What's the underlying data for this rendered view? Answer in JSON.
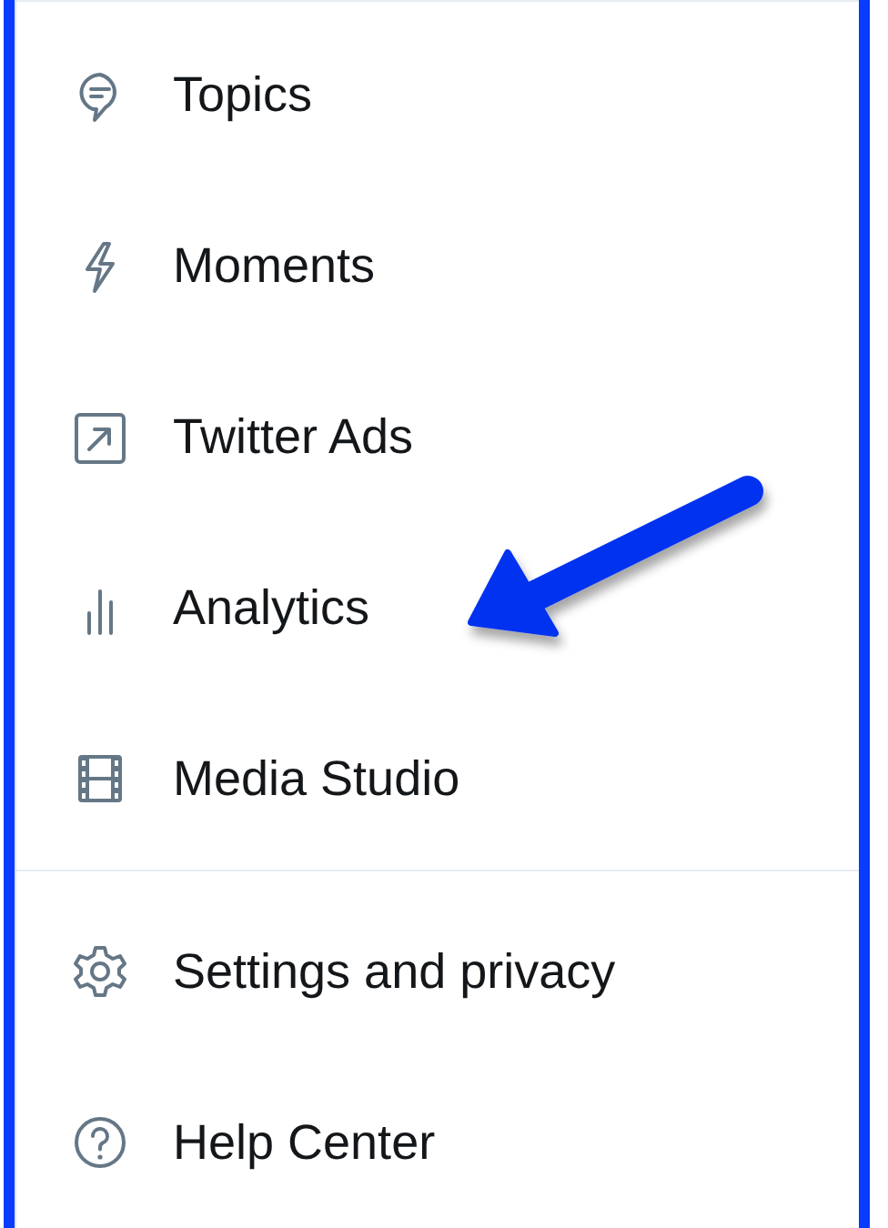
{
  "menu": {
    "groups": [
      {
        "items": [
          {
            "label": "Topics",
            "annotated": false
          },
          {
            "label": "Moments",
            "annotated": false
          },
          {
            "label": "Twitter Ads",
            "annotated": false
          },
          {
            "label": "Analytics",
            "annotated": true
          },
          {
            "label": "Media Studio",
            "annotated": false
          }
        ]
      },
      {
        "items": [
          {
            "label": "Settings and privacy",
            "annotated": false
          },
          {
            "label": "Help Center",
            "annotated": false
          }
        ]
      }
    ]
  }
}
